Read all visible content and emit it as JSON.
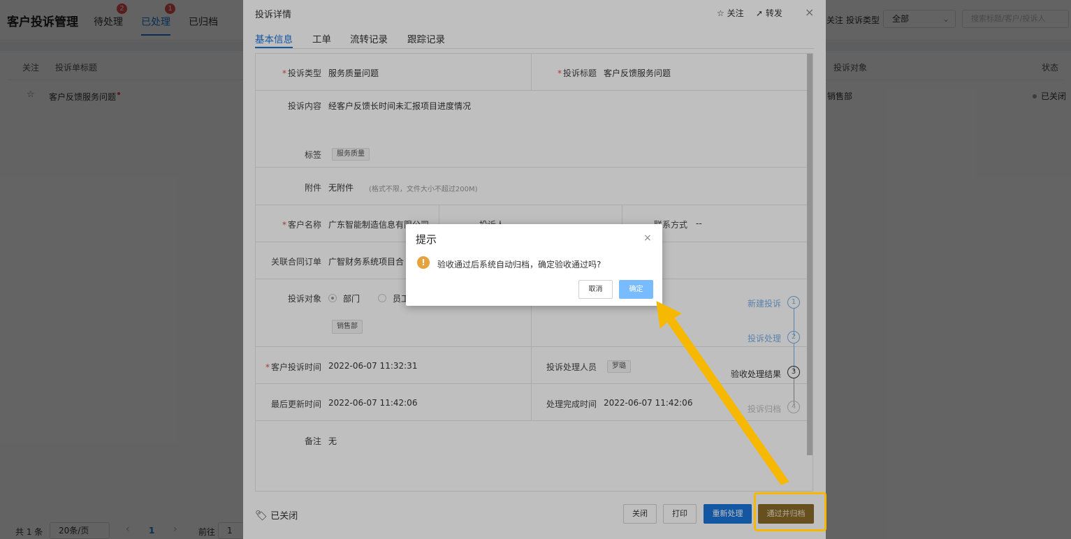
{
  "app": {
    "title": "客户投诉管理",
    "tabs": [
      {
        "label": "待处理",
        "badge": "2"
      },
      {
        "label": "已处理",
        "badge": "1"
      },
      {
        "label": "已归档"
      }
    ],
    "filters": {
      "follow_label": "关注",
      "type_label": "投诉类型",
      "type_value": "全部",
      "search_placeholder": "搜索标题/客户/投诉人"
    }
  },
  "list": {
    "headers": {
      "follow": "关注",
      "title": "投诉单标题",
      "target": "投诉对象",
      "status": "状态"
    },
    "rows": [
      {
        "title": "客户反馈服务问题",
        "target": "销售部",
        "status": "已关闭"
      }
    ],
    "pager": {
      "total": "共 1 条",
      "page_size": "20条/页",
      "prev": "‹",
      "current": "1",
      "next": "›",
      "goto_label": "前往",
      "goto_value": "1"
    }
  },
  "drawer": {
    "title": "投诉详情",
    "follow_label": "关注",
    "forward_label": "转发",
    "close": "×",
    "tabs": [
      "基本信息",
      "工单",
      "流转记录",
      "跟踪记录"
    ],
    "fields": {
      "type_label": "投诉类型",
      "type_value": "服务质量问题",
      "title_label": "投诉标题",
      "title_value": "客户反馈服务问题",
      "content_label": "投诉内容",
      "content_value": "经客户反馈长时间未汇报项目进度情况",
      "tag_label": "标签",
      "tag_value": "服务质量",
      "attach_label": "附件",
      "attach_value": "无附件",
      "attach_hint": "(格式不限，文件大小不超过200M)",
      "customer_label": "客户名称",
      "customer_value": "广东智能制造信息有限公司",
      "complainant_label": "投诉人",
      "contact_label": "联系方式",
      "contact_value": "--",
      "contract_label": "关联合同订单",
      "contract_value": "广智财务系统项目合",
      "target_label": "投诉对象",
      "target_opt1": "部门",
      "target_opt2": "员工",
      "target_value": "销售部",
      "time_label": "客户投诉时间",
      "time_value": "2022-06-07 11:32:31",
      "handler_label": "投诉处理人员",
      "handler_value": "罗璐",
      "updated_label": "最后更新时间",
      "updated_value": "2022-06-07 11:42:06",
      "done_label": "处理完成时间",
      "done_value": "2022-06-07 11:42:06",
      "remark_label": "备注",
      "remark_value": "无"
    },
    "steps": [
      {
        "label": "新建投诉",
        "num": "1",
        "color": "#7aaee6"
      },
      {
        "label": "投诉处理",
        "num": "2",
        "color": "#7aaee6"
      },
      {
        "label": "验收处理结果",
        "num": "3",
        "color": "#333333"
      },
      {
        "label": "投诉归档",
        "num": "4",
        "color": "#c0c0c0"
      }
    ],
    "footer": {
      "status": "已关闭",
      "close_btn": "关闭",
      "print_btn": "打印",
      "reprocess_btn": "重新处理",
      "pass_archive_btn": "通过并归档"
    }
  },
  "dialog": {
    "title": "提示",
    "close": "×",
    "icon": "!",
    "message": "验收通过后系统自动归档，确定验收通过吗?",
    "cancel": "取消",
    "confirm": "确定"
  },
  "colors": {
    "accent": "#1a73d9",
    "highlight": "#f6b800",
    "warning": "#e6a23c",
    "danger": "#e34d4d"
  }
}
